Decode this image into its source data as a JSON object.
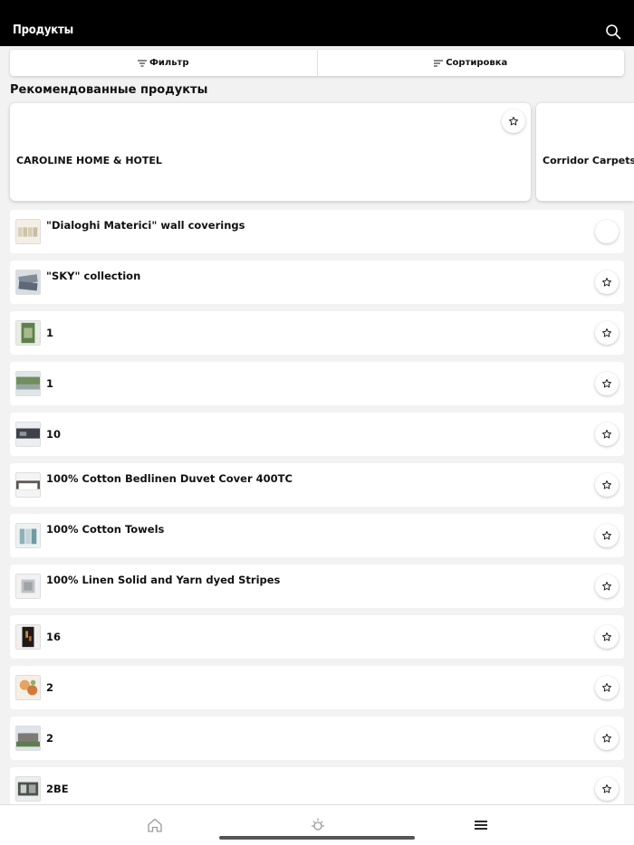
{
  "header": {
    "title": "Продукты",
    "search_icon": "search-icon"
  },
  "toolbar": {
    "filter_label": "Фильтр",
    "sort_label": "Сортировка"
  },
  "featured": {
    "title": "Рекомендованные продукты",
    "items": [
      {
        "name": "CAROLINE HOME & HOTEL",
        "favorite_icon": "star-icon"
      },
      {
        "name": "Corridor Carpets",
        "favorite_icon": "star-icon"
      }
    ]
  },
  "products": [
    {
      "name": "\"Dialoghi Materici\" wall coverings",
      "thumb": "wall-covering-thumbnail"
    },
    {
      "name": "\"SKY\" collection",
      "thumb": "sky-collection-thumbnail"
    },
    {
      "name": "1",
      "thumb": "garden-thumbnail"
    },
    {
      "name": "1",
      "thumb": "street-thumbnail"
    },
    {
      "name": "10",
      "thumb": "dark-room-thumbnail"
    },
    {
      "name": "100% Cotton Bedlinen Duvet Cover 400TC",
      "thumb": "bedlinen-thumbnail"
    },
    {
      "name": "100% Cotton Towels",
      "thumb": "towels-thumbnail"
    },
    {
      "name": "100% Linen Solid and Yarn dyed Stripes",
      "thumb": "linen-thumbnail"
    },
    {
      "name": "16",
      "thumb": "night-thumbnail"
    },
    {
      "name": "2",
      "thumb": "food-thumbnail"
    },
    {
      "name": "2",
      "thumb": "building-thumbnail"
    },
    {
      "name": "2BE",
      "thumb": "interior-thumbnail"
    }
  ],
  "tabbar": {
    "items": [
      "home-icon",
      "sun-icon",
      "menu-icon"
    ]
  }
}
